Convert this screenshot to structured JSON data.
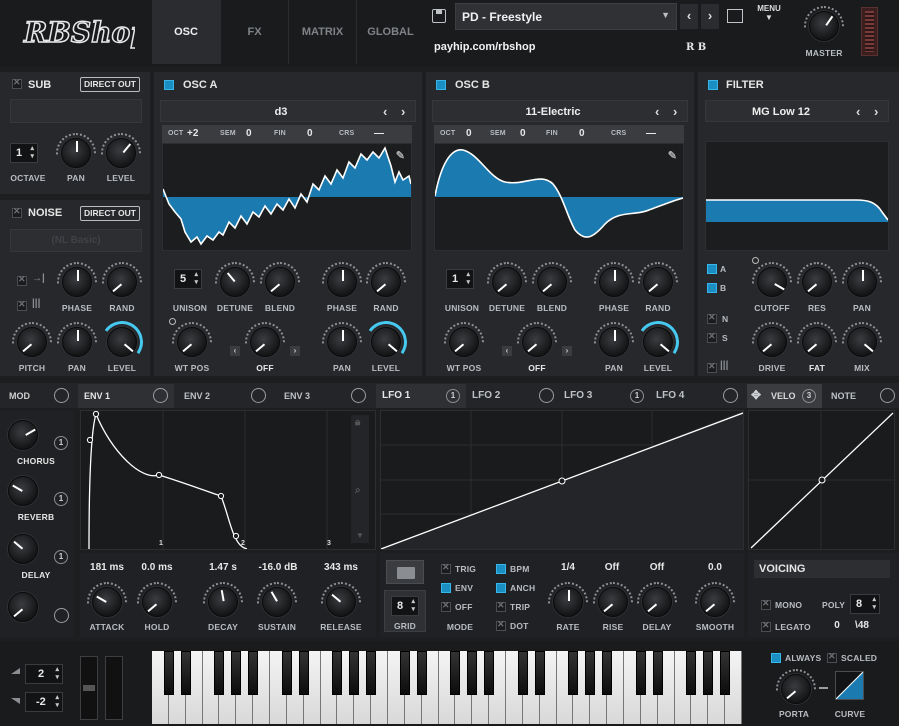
{
  "header": {
    "logo": "RBShop",
    "tabs": [
      "OSC",
      "FX",
      "MATRIX",
      "GLOBAL"
    ],
    "active_tab": "OSC",
    "preset_name": "PD - Freestyle",
    "author_link": "payhip.com/rbshop",
    "author_mark": "R B",
    "menu_label": "MENU",
    "master_label": "MASTER"
  },
  "sub": {
    "title": "SUB",
    "direct_out": "DIRECT OUT",
    "octave_value": "1",
    "labels": [
      "OCTAVE",
      "PAN",
      "LEVEL"
    ]
  },
  "noise": {
    "title": "NOISE",
    "direct_out": "DIRECT OUT",
    "sample": "(NL Basic)",
    "labels": [
      "PHASE",
      "RAND",
      "PITCH",
      "PAN",
      "LEVEL"
    ]
  },
  "osc_a": {
    "title": "OSC A",
    "wavetable": "d3",
    "oct_label": "OCT",
    "oct": "+2",
    "sem_label": "SEM",
    "sem": "0",
    "fin_label": "FIN",
    "fin": "0",
    "crs_label": "CRS",
    "crs": "—",
    "unison": "5",
    "wt_mode": "OFF",
    "labels": [
      "UNISON",
      "DETUNE",
      "BLEND",
      "PHASE",
      "RAND",
      "WT POS",
      "PAN",
      "LEVEL"
    ]
  },
  "osc_b": {
    "title": "OSC B",
    "wavetable": "11-Electric",
    "oct_label": "OCT",
    "oct": "0",
    "sem_label": "SEM",
    "sem": "0",
    "fin_label": "FIN",
    "fin": "0",
    "crs_label": "CRS",
    "crs": "—",
    "unison": "1",
    "wt_mode": "OFF",
    "labels": [
      "UNISON",
      "DETUNE",
      "BLEND",
      "PHASE",
      "RAND",
      "WT POS",
      "PAN",
      "LEVEL"
    ]
  },
  "filter": {
    "title": "FILTER",
    "type": "MG Low 12",
    "routes": [
      "A",
      "B",
      "N",
      "S"
    ],
    "labels": [
      "CUTOFF",
      "RES",
      "PAN",
      "DRIVE",
      "FAT",
      "MIX"
    ]
  },
  "mod_bar": {
    "mod": "MOD",
    "tabs": [
      "ENV 1",
      "ENV 2",
      "ENV 3",
      "LFO 1",
      "LFO 2",
      "LFO 3",
      "LFO 4",
      "VELO",
      "NOTE"
    ],
    "lfo1_badge": "1",
    "lfo3_badge": "1",
    "velo_badge": "3"
  },
  "macros": [
    {
      "label": "CHORUS",
      "badge": "1"
    },
    {
      "label": "REVERB",
      "badge": "1"
    },
    {
      "label": "DELAY",
      "badge": "1"
    },
    {
      "label": "",
      "badge": ""
    }
  ],
  "env": {
    "markers": [
      "1",
      "2",
      "3"
    ],
    "values": [
      "181 ms",
      "0.0 ms",
      "1.47 s",
      "-16.0 dB",
      "343 ms"
    ],
    "labels": [
      "ATTACK",
      "HOLD",
      "DECAY",
      "SUSTAIN",
      "RELEASE"
    ]
  },
  "lfo": {
    "grid_value": "8",
    "grid_label": "GRID",
    "mode_label": "MODE",
    "options": [
      "TRIG",
      "ENV",
      "OFF",
      "BPM",
      "ANCH",
      "TRIP",
      "DOT"
    ],
    "values": [
      "1/4",
      "Off",
      "Off",
      "0.0"
    ],
    "labels": [
      "RATE",
      "RISE",
      "DELAY",
      "SMOOTH"
    ]
  },
  "voicing": {
    "title": "VOICING",
    "mono": "MONO",
    "legato": "LEGATO",
    "poly_label": "POLY",
    "poly": "8",
    "count": "0",
    "max": "\\48",
    "always": "ALWAYS",
    "scaled": "SCALED",
    "porta": "PORTA",
    "curve": "CURVE"
  },
  "keyboard": {
    "pitch_up": "2",
    "pitch_down": "-2"
  },
  "colors": {
    "accent": "#47c8f0",
    "wave_fill": "#1b7ab0",
    "panel": "#26282b",
    "bg": "#1d1e20"
  }
}
